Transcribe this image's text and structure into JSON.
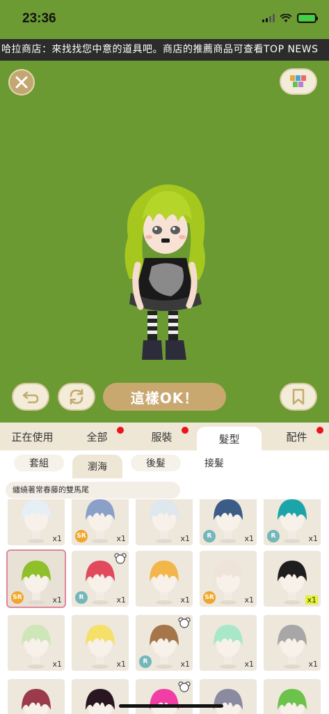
{
  "status": {
    "time": "23:36"
  },
  "marquee": {
    "text": "哈拉商店：來找找您中意的道具吧。商店的推薦商品可查看TOP NEWS"
  },
  "stage": {
    "ok_label": "這樣OK！",
    "icons": [
      "close-icon",
      "layout-grid-icon",
      "undo-icon",
      "rotate-icon",
      "bookmark-icon"
    ]
  },
  "category_tabs": [
    {
      "label": "正在使用",
      "dot": false
    },
    {
      "label": "全部",
      "dot": true
    },
    {
      "label": "服裝",
      "dot": true
    },
    {
      "label": "髮型",
      "dot": false,
      "active": true
    },
    {
      "label": "配件",
      "dot": true
    }
  ],
  "sub_tabs": [
    {
      "label": "套組"
    },
    {
      "label": "瀏海",
      "active": true
    },
    {
      "label": "後髮"
    },
    {
      "label": "接髮"
    }
  ],
  "item_name": "纏繞著常春藤的雙馬尾",
  "items": [
    {
      "color": "#e6eef6",
      "rarity": "",
      "count": "x1"
    },
    {
      "color": "#8aa0c8",
      "rarity": "SR",
      "count": "x1"
    },
    {
      "color": "#dfe7ee",
      "rarity": "",
      "count": "x1"
    },
    {
      "color": "#3a5c86",
      "rarity": "R",
      "count": "x1"
    },
    {
      "color": "#1aa6a8",
      "rarity": "R",
      "count": "x1"
    },
    {
      "color": "#8fbf2a",
      "rarity": "SR",
      "count": "x1",
      "selected": true
    },
    {
      "color": "#e04a5c",
      "rarity": "R",
      "count": "x1",
      "bear": true
    },
    {
      "color": "#f2b64a",
      "rarity": "",
      "count": "x1"
    },
    {
      "color": "#f0e4da",
      "rarity": "SR",
      "count": "x1"
    },
    {
      "color": "#1e1e1e",
      "rarity": "",
      "count": "x1",
      "highlight": true
    },
    {
      "color": "#cfe6b8",
      "rarity": "",
      "count": "x1"
    },
    {
      "color": "#f5e06a",
      "rarity": "",
      "count": "x1"
    },
    {
      "color": "#a6764a",
      "rarity": "R",
      "count": "x1",
      "bear": true
    },
    {
      "color": "#a8e8c8",
      "rarity": "",
      "count": "x1"
    },
    {
      "color": "#a7a7a7",
      "rarity": "",
      "count": "x1"
    },
    {
      "color": "#9a3a4a",
      "rarity": "",
      "count": ""
    },
    {
      "color": "#2a1620",
      "rarity": "",
      "count": ""
    },
    {
      "color": "#f03ea4",
      "rarity": "",
      "count": "",
      "bear": true
    },
    {
      "color": "#8a8aa0",
      "rarity": "",
      "count": ""
    },
    {
      "color": "#6cc24a",
      "rarity": "",
      "count": ""
    }
  ]
}
